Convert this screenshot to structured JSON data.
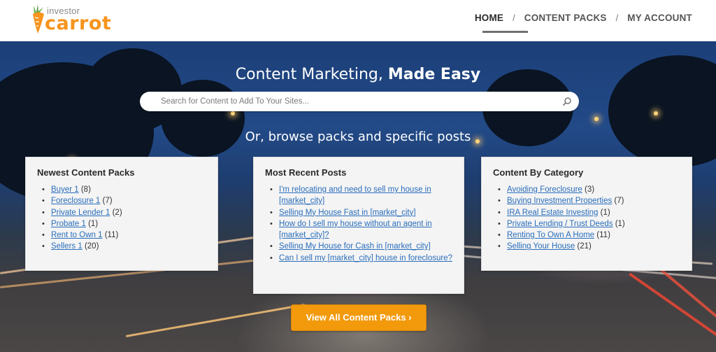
{
  "brand": {
    "logo_small": "investor",
    "logo_big": "carrot",
    "accent": "#f7941d"
  },
  "nav": {
    "items": [
      {
        "label": "HOME",
        "active": true
      },
      {
        "label": "CONTENT PACKS",
        "active": false
      },
      {
        "label": "MY ACCOUNT",
        "active": false
      }
    ],
    "separator": "/"
  },
  "hero": {
    "title_regular": "Content Marketing, ",
    "title_bold": "Made Easy",
    "search_placeholder": "Search for Content to Add To Your Sites...",
    "subtitle": "Or, browse packs and specific posts"
  },
  "newest_packs": {
    "title": "Newest Content Packs",
    "items": [
      {
        "label": "Buyer 1",
        "count": "(8)"
      },
      {
        "label": "Foreclosure 1",
        "count": "(7)"
      },
      {
        "label": "Private Lender 1",
        "count": "(2)"
      },
      {
        "label": "Probate 1",
        "count": "(1)"
      },
      {
        "label": "Rent to Own 1",
        "count": "(11)"
      },
      {
        "label": "Sellers 1",
        "count": "(20)"
      }
    ]
  },
  "recent_posts": {
    "title": "Most Recent Posts",
    "items": [
      {
        "label": "I'm relocating and need to sell my house in [market_city]"
      },
      {
        "label": "Selling My House Fast in [market_city]"
      },
      {
        "label": "How do I sell my house without an agent in [market_city]?"
      },
      {
        "label": "Selling My House for Cash in [market_city]"
      },
      {
        "label": "Can I sell my [market_city] house in foreclosure?"
      }
    ]
  },
  "categories": {
    "title": "Content By Category",
    "items": [
      {
        "label": "Avoiding Foreclosure",
        "count": "(3)"
      },
      {
        "label": "Buying Investment Properties",
        "count": "(7)"
      },
      {
        "label": "IRA Real Estate Investing",
        "count": "(1)"
      },
      {
        "label": "Private Lending / Trust Deeds",
        "count": "(1)"
      },
      {
        "label": "Renting To Own A Home",
        "count": "(11)"
      },
      {
        "label": "Selling Your House",
        "count": "(21)"
      }
    ]
  },
  "cta": {
    "label": "View All Content Packs ›",
    "color": "#f29a0c"
  },
  "link_color": "#2a6ebb"
}
